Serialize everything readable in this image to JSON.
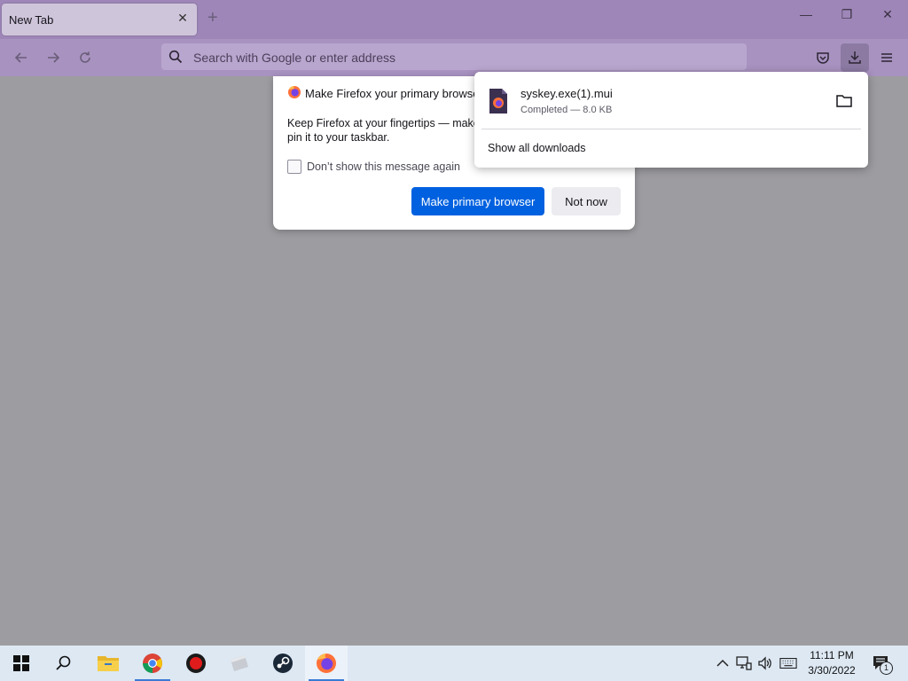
{
  "tab": {
    "title": "New Tab",
    "close": "✕"
  },
  "new_tab": "+",
  "window_controls": {
    "minimize": "—",
    "restore": "❐",
    "close": "✕"
  },
  "urlbar": {
    "placeholder": "Search with Google or enter address"
  },
  "dialog": {
    "title": "Make Firefox your primary browser?",
    "body": "Keep Firefox at your fingertips — make it your primary browser and pin it to your taskbar.",
    "checkbox_label": "Don’t show this message again",
    "primary_button": "Make primary browser",
    "secondary_button": "Not now"
  },
  "downloads": {
    "file_name": "syskey.exe(1).mui",
    "status": "Completed — 8.0 KB",
    "show_all": "Show all downloads"
  },
  "taskbar": {
    "items": [
      "start-icon",
      "search-icon",
      "file-explorer-icon",
      "chrome-icon",
      "record-icon",
      "app-icon",
      "steam-icon",
      "firefox-icon"
    ],
    "clock_time": "11:11 PM",
    "clock_date": "3/30/2022",
    "notification_count": "1"
  },
  "colors": {
    "titlebar": "#9e87b8",
    "navbar": "#a892c0",
    "primary_button": "#0061e0",
    "content_bg": "#9d9ca0",
    "taskbar": "#dde8f3"
  }
}
